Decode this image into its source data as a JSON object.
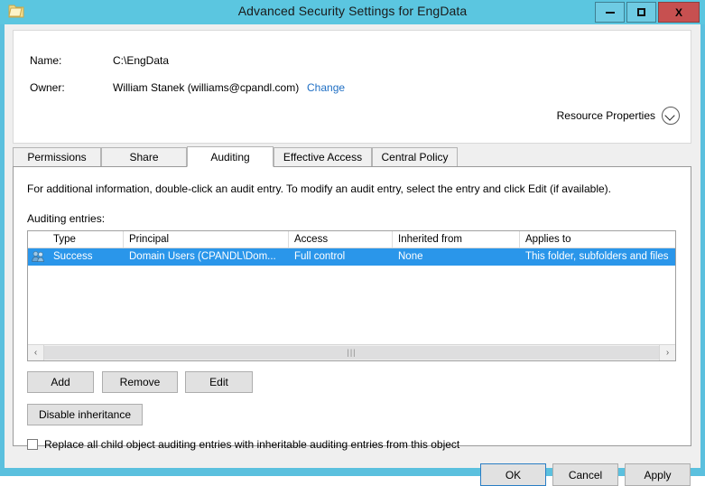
{
  "window": {
    "title": "Advanced Security Settings for EngData",
    "icon": "folder-icon",
    "minimize_label": "Minimize",
    "maximize_label": "Maximize",
    "close_label": "X",
    "titlebar_color": "#5bc6e0",
    "close_color": "#c75050"
  },
  "header": {
    "name_label": "Name:",
    "name_value": "C:\\EngData",
    "owner_label": "Owner:",
    "owner_value": "William Stanek (williams@cpandl.com)",
    "change_link": "Change",
    "resource_properties_label": "Resource Properties",
    "resource_properties_icon": "chevron-down-circle-icon"
  },
  "tabs": [
    {
      "label": "Permissions",
      "active": false
    },
    {
      "label": "Share",
      "active": false
    },
    {
      "label": "Auditing",
      "active": true
    },
    {
      "label": "Effective Access",
      "active": false
    },
    {
      "label": "Central Policy",
      "active": false
    }
  ],
  "panel": {
    "info_text": "For additional information, double-click an audit entry. To modify an audit entry, select the entry and click Edit (if available).",
    "entries_label": "Auditing entries:"
  },
  "table": {
    "columns": [
      "Type",
      "Principal",
      "Access",
      "Inherited from",
      "Applies to"
    ],
    "rows": [
      {
        "icon": "users-group-icon",
        "selected": true,
        "cells": [
          "Success",
          "Domain Users (CPANDL\\Dom...",
          "Full control",
          "None",
          "This folder, subfolders and files"
        ]
      }
    ],
    "selection_color": "#2a96ea",
    "scrollbar": {
      "left_arrow": "‹",
      "right_arrow": "›",
      "grip": "|||"
    }
  },
  "actions": {
    "add_label": "Add",
    "remove_label": "Remove",
    "edit_label": "Edit",
    "disable_inheritance_label": "Disable inheritance"
  },
  "checkbox": {
    "label": "Replace all child object auditing entries with inheritable auditing entries from this object",
    "checked": false
  },
  "footer": {
    "ok_label": "OK",
    "cancel_label": "Cancel",
    "apply_label": "Apply"
  }
}
